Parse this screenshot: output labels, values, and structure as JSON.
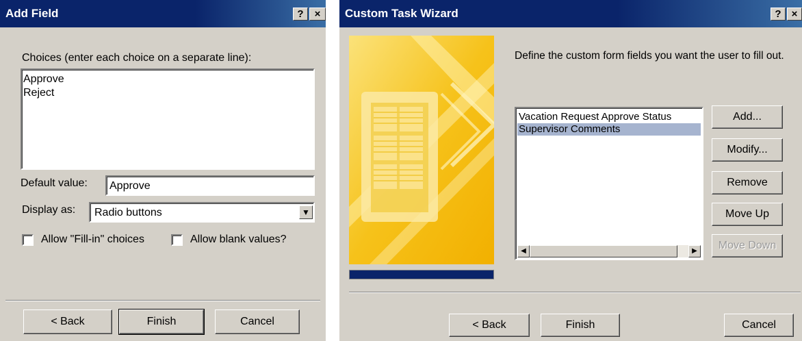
{
  "add_field": {
    "title": "Add Field",
    "help_label": "?",
    "close_label": "×",
    "choices_label": "Choices (enter each choice on a separate line):",
    "choices": [
      "Approve",
      "Reject"
    ],
    "default_value_label": "Default value:",
    "default_value": "Approve",
    "display_as_label": "Display as:",
    "display_as_value": "Radio buttons",
    "allow_fillin_label": "Allow \"Fill-in\" choices",
    "allow_blank_label": "Allow blank values?",
    "back_label": "< Back",
    "finish_label": "Finish",
    "cancel_label": "Cancel"
  },
  "wizard": {
    "title": "Custom Task Wizard",
    "help_label": "?",
    "close_label": "×",
    "description": "Define the custom form fields you want the user to fill out.",
    "fields": [
      "Vacation Request Approve Status",
      "Supervisor Comments"
    ],
    "selected_field": "Supervisor Comments",
    "add_label": "Add...",
    "modify_label": "Modify...",
    "remove_label": "Remove",
    "move_up_label": "Move Up",
    "move_down_label": "Move Down",
    "back_label": "< Back",
    "finish_label": "Finish",
    "cancel_label": "Cancel"
  },
  "colors": {
    "titlebar": "#0a246a",
    "dialog_bg": "#d4d0c8",
    "selection": "#a6b4cf",
    "progress": "#0a246a",
    "art_yellow": "#f6c21a"
  },
  "icons": {
    "dropdown": "chevron-down-icon",
    "scroll_left": "arrow-left-icon",
    "scroll_right": "arrow-right-icon"
  }
}
